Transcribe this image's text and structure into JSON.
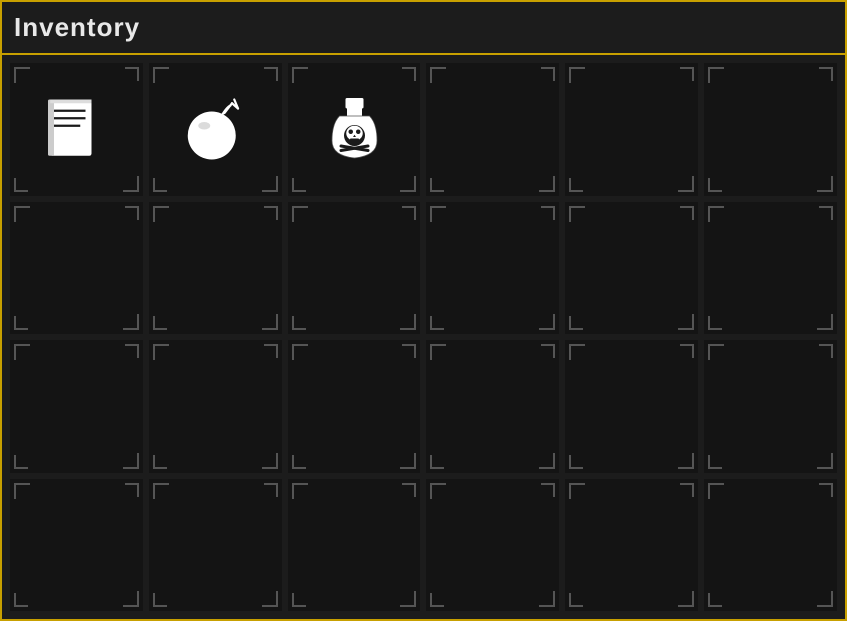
{
  "header": {
    "title": "Inventory",
    "border_color": "#c8a000"
  },
  "grid": {
    "columns": 6,
    "rows": 4,
    "slots": [
      {
        "id": 0,
        "has_item": true,
        "item": "book"
      },
      {
        "id": 1,
        "has_item": true,
        "item": "bomb"
      },
      {
        "id": 2,
        "has_item": true,
        "item": "poison"
      },
      {
        "id": 3,
        "has_item": false,
        "item": null
      },
      {
        "id": 4,
        "has_item": false,
        "item": null
      },
      {
        "id": 5,
        "has_item": false,
        "item": null
      },
      {
        "id": 6,
        "has_item": false,
        "item": null
      },
      {
        "id": 7,
        "has_item": false,
        "item": null
      },
      {
        "id": 8,
        "has_item": false,
        "item": null
      },
      {
        "id": 9,
        "has_item": false,
        "item": null
      },
      {
        "id": 10,
        "has_item": false,
        "item": null
      },
      {
        "id": 11,
        "has_item": false,
        "item": null
      },
      {
        "id": 12,
        "has_item": false,
        "item": null
      },
      {
        "id": 13,
        "has_item": false,
        "item": null
      },
      {
        "id": 14,
        "has_item": false,
        "item": null
      },
      {
        "id": 15,
        "has_item": false,
        "item": null
      },
      {
        "id": 16,
        "has_item": false,
        "item": null
      },
      {
        "id": 17,
        "has_item": false,
        "item": null
      },
      {
        "id": 18,
        "has_item": false,
        "item": null
      },
      {
        "id": 19,
        "has_item": false,
        "item": null
      },
      {
        "id": 20,
        "has_item": false,
        "item": null
      },
      {
        "id": 21,
        "has_item": false,
        "item": null
      },
      {
        "id": 22,
        "has_item": false,
        "item": null
      },
      {
        "id": 23,
        "has_item": false,
        "item": null
      }
    ]
  }
}
